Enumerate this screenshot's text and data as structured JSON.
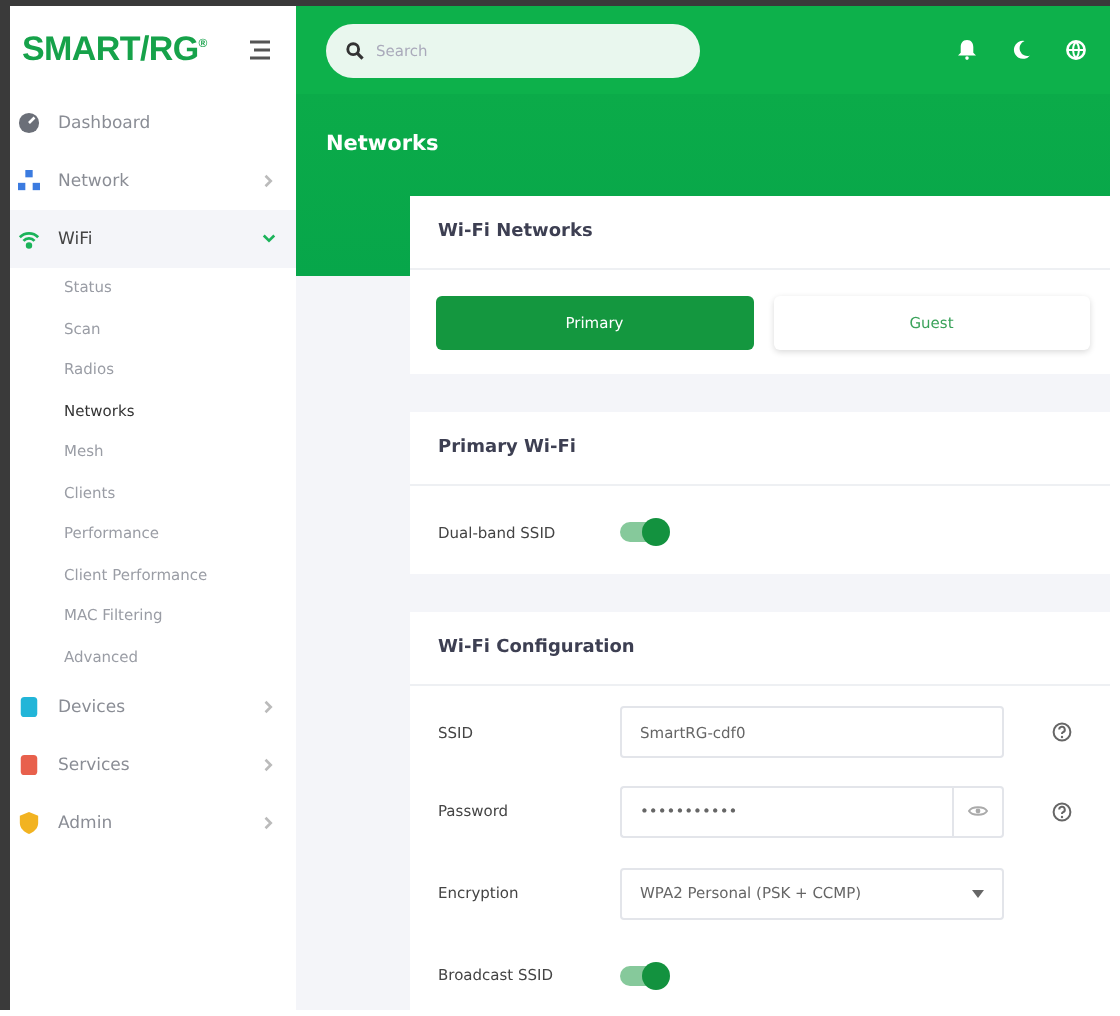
{
  "logo": "SMART/RG$^{®}$",
  "sidebar": {
    "items": [
      {
        "label": "Dashboard",
        "selected": false
      },
      {
        "label": "Network",
        "selected": false,
        "expanded": false,
        "has_children": true
      },
      {
        "label": "WiFi",
        "selected": true,
        "expanded": true,
        "has_children": true,
        "children": [
          {
            "label": "Status",
            "selected": false
          },
          {
            "label": "Scan",
            "selected": false
          },
          {
            "label": "Radios",
            "selected": false
          },
          {
            "label": "Networks",
            "selected": true
          },
          {
            "label": "Mesh",
            "selected": false
          },
          {
            "label": "Clients",
            "selected": false
          },
          {
            "label": "Performance",
            "selected": false
          },
          {
            "label": "Client Performance",
            "selected": false
          },
          {
            "label": "MAC Filtering",
            "selected": false
          },
          {
            "label": "Advanced",
            "selected": false
          }
        ]
      },
      {
        "label": "Devices",
        "selected": false,
        "expanded": false,
        "has_children": true
      },
      {
        "label": "Services",
        "selected": false,
        "expanded": false,
        "has_children": true
      },
      {
        "label": "Admin",
        "selected": false,
        "expanded": false,
        "has_children": true
      }
    ]
  },
  "search": {
    "placeholder": "Search"
  },
  "page_title": "Networks",
  "wifi_networks": {
    "title": "Wi-Fi Networks",
    "tabs": [
      {
        "label": "Primary",
        "selected": true
      },
      {
        "label": "Guest",
        "selected": false
      }
    ]
  },
  "primary_wifi": {
    "title": "Primary Wi-Fi",
    "rows": [
      {
        "kind": "toggle",
        "label": "Dual-band SSID",
        "on": true
      }
    ]
  },
  "wifi_configuration": {
    "title": "Wi-Fi Configuration",
    "rows": [
      {
        "kind": "text",
        "label": "SSID",
        "value": "SmartRG-cdf0",
        "help": true
      },
      {
        "kind": "password",
        "label": "Password",
        "value": "•••••••••••",
        "help": true
      },
      {
        "kind": "select",
        "label": "Encryption",
        "value": "WPA2 Personal (PSK + CCMP)"
      },
      {
        "kind": "toggle",
        "label": "Broadcast SSID",
        "on": true
      }
    ]
  }
}
